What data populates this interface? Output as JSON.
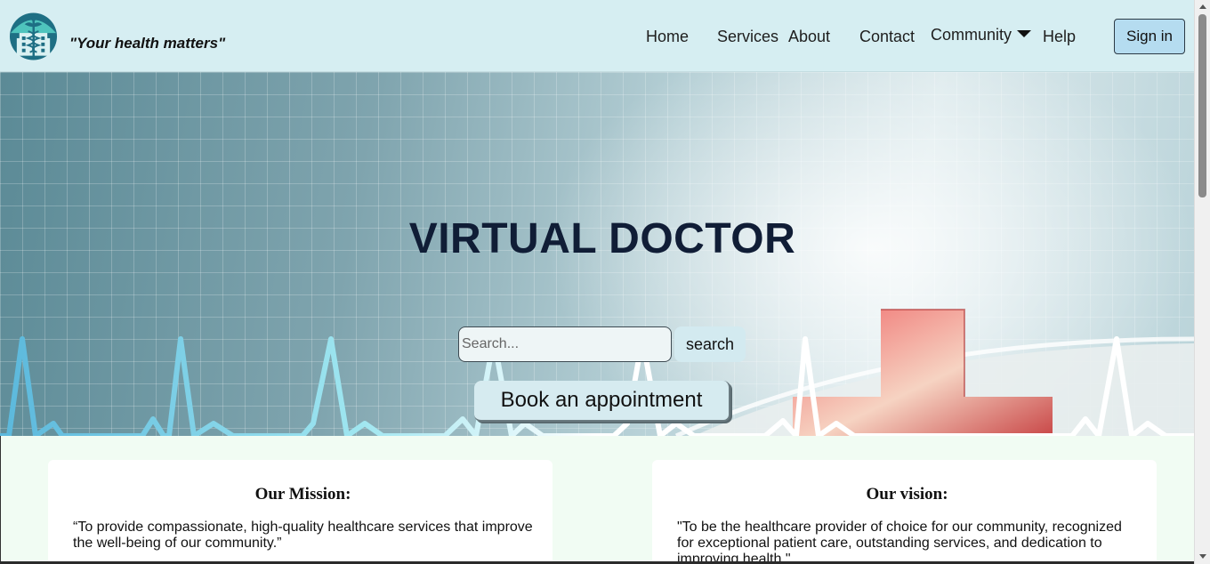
{
  "header": {
    "logo_icon": "hospital-caduceus-logo-icon",
    "tagline": "\"Your health matters\"",
    "nav": [
      {
        "label": "Home"
      },
      {
        "label": "Services"
      },
      {
        "label": "About"
      },
      {
        "label": "Contact"
      },
      {
        "label": "Community"
      },
      {
        "label": "Help"
      }
    ],
    "community_dropdown_icon": "caret-down-icon",
    "signin_label": "Sign in"
  },
  "hero": {
    "title": "VIRTUAL DOCTOR",
    "search_placeholder": "Search...",
    "search_value": "",
    "search_button": "search",
    "book_button": "Book an appointment",
    "background": "heartbeat-line-and-red-cross-image"
  },
  "cards": [
    {
      "title": "Our Mission:",
      "text": "“To provide compassionate, high-quality healthcare services that improve the well-being of our community.”"
    },
    {
      "title": "Our vision:",
      "text": "\"To be the healthcare provider of choice for our community, recognized for exceptional patient care, outstanding services, and dedication to improving health.\""
    }
  ],
  "colors": {
    "header_bg": "#d6eef2",
    "signin_bg": "#b5dcf0",
    "title": "#101d36",
    "cross_red": "#d9534f",
    "logo_teal": "#1e6f84",
    "page_bg": "#f1fcf3"
  }
}
